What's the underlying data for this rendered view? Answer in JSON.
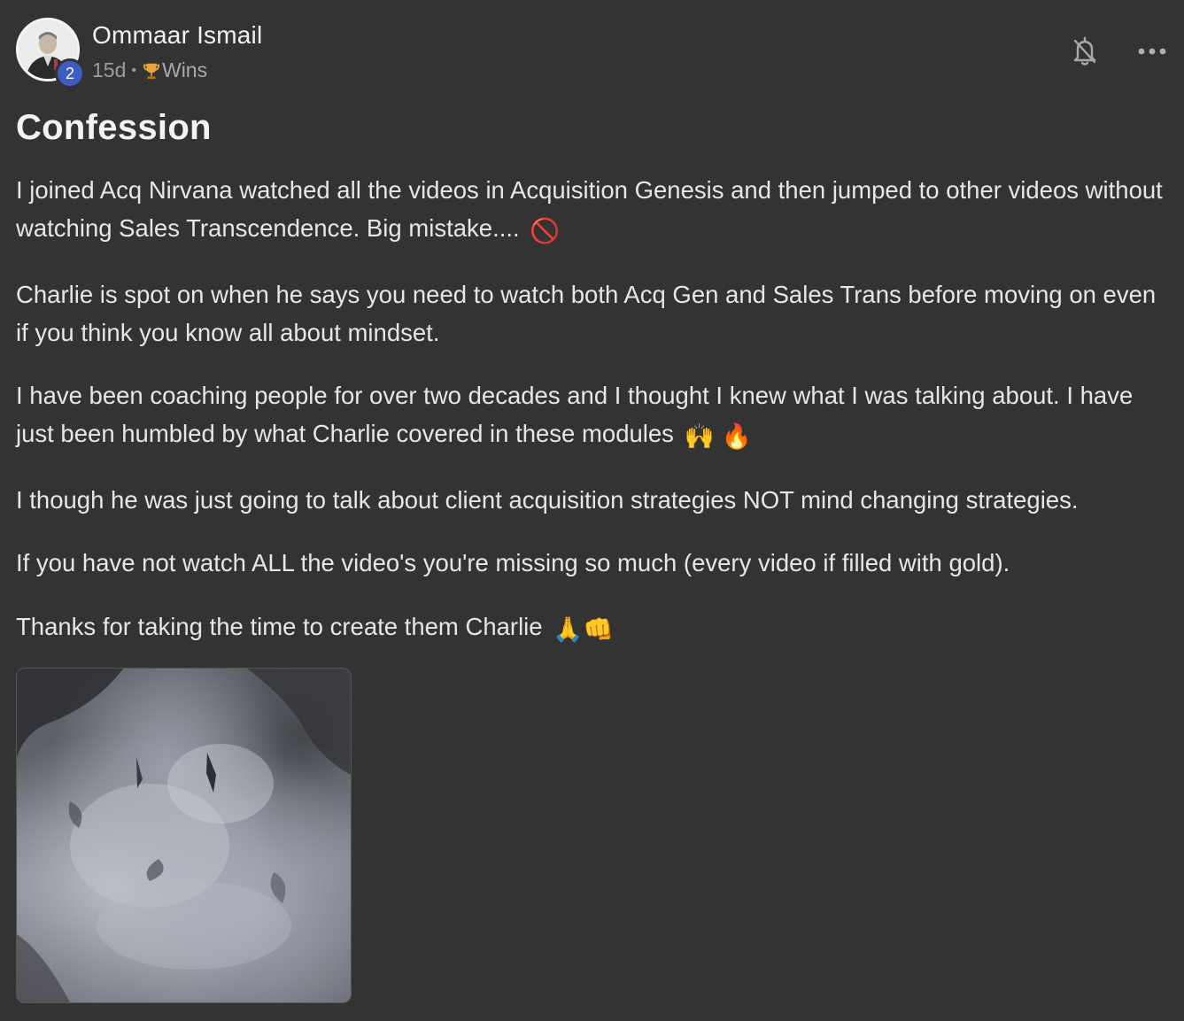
{
  "author": {
    "name": "Ommaar Ismail",
    "level": "2"
  },
  "meta": {
    "age": "15d",
    "separator": "•",
    "category": "Wins",
    "category_icon": "trophy-icon"
  },
  "actions": {
    "notifications_icon": "bell-off-icon",
    "more_icon": "more-horizontal-icon"
  },
  "post": {
    "title": "Confession",
    "paragraphs": [
      {
        "text": "I joined Acq Nirvana watched all the videos in Acquisition Genesis and then jumped to other videos without watching Sales Transcendence. Big mistake....",
        "emoji": "🚫"
      },
      {
        "text": "Charlie is spot on when he says you need to watch both Acq Gen and Sales Trans before moving on even if you think you know all about mindset.",
        "emoji": ""
      },
      {
        "text": "I have been coaching people for over two decades and I thought I knew what I was talking about. I have just been humbled by what Charlie covered in these modules",
        "emoji": "🙌 🔥"
      },
      {
        "text": "I though he was just going to talk about client acquisition strategies NOT mind changing strategies.",
        "emoji": ""
      },
      {
        "text": "If you have not watch ALL the video's you're missing so much (every video if filled with gold).",
        "emoji": ""
      },
      {
        "text": "Thanks for taking the time to create them Charlie",
        "emoji": "🙏👊"
      }
    ]
  },
  "colors": {
    "background": "#333333",
    "text": "#e6e6e6",
    "muted": "#9c9c9c",
    "level_badge": "#3d5cc4"
  }
}
